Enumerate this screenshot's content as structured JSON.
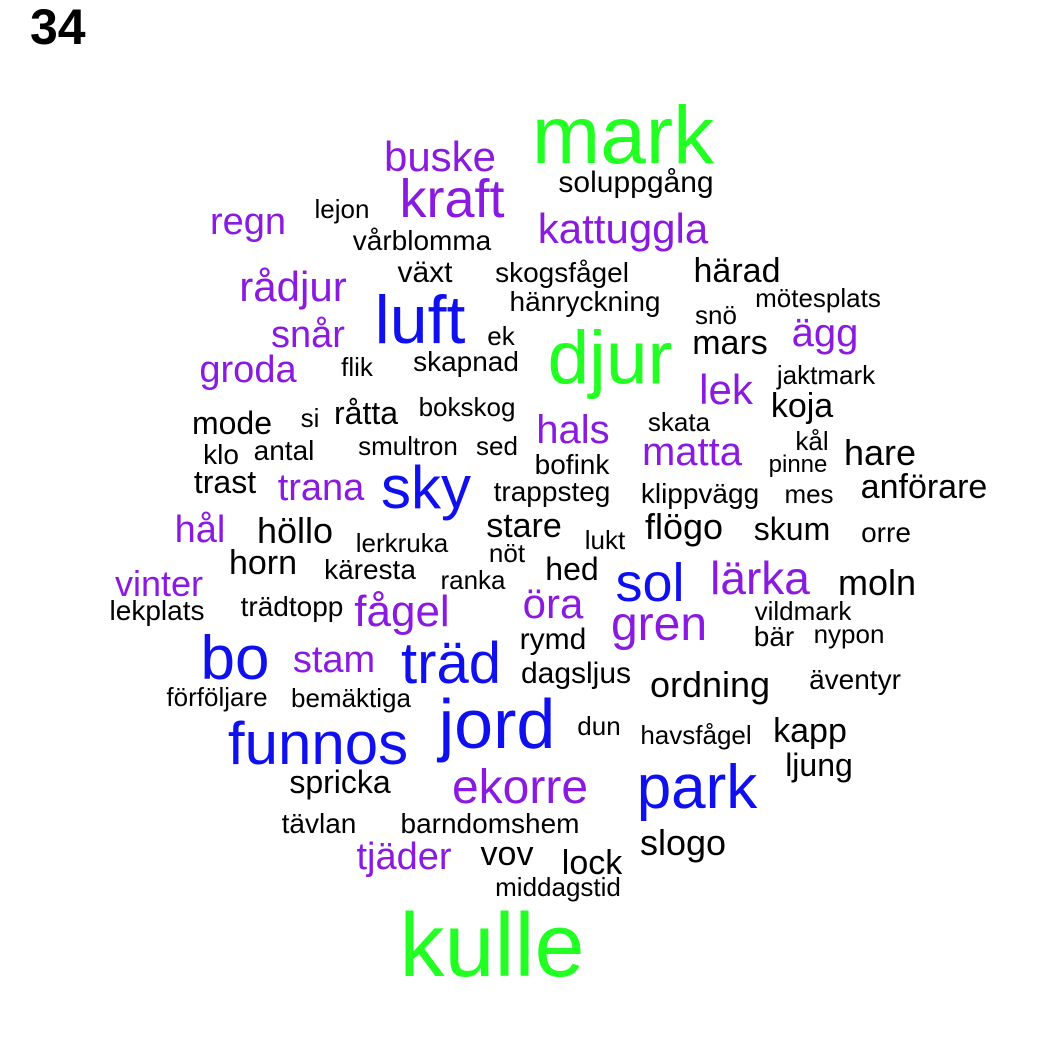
{
  "panel_number": "34",
  "colors": {
    "green": "#22ff22",
    "blue": "#1010ee",
    "purple": "#8a1ae0",
    "black": "#000000"
  },
  "words": [
    {
      "text": "mark",
      "color": "green"
    },
    {
      "text": "kulle",
      "color": "green"
    },
    {
      "text": "djur",
      "color": "green"
    },
    {
      "text": "luft",
      "color": "blue"
    },
    {
      "text": "sky",
      "color": "blue"
    },
    {
      "text": "sol",
      "color": "blue"
    },
    {
      "text": "bo",
      "color": "blue"
    },
    {
      "text": "träd",
      "color": "blue"
    },
    {
      "text": "jord",
      "color": "blue"
    },
    {
      "text": "funnos",
      "color": "blue"
    },
    {
      "text": "park",
      "color": "blue"
    },
    {
      "text": "buske",
      "color": "purple"
    },
    {
      "text": "kraft",
      "color": "purple"
    },
    {
      "text": "regn",
      "color": "purple"
    },
    {
      "text": "kattuggla",
      "color": "purple"
    },
    {
      "text": "rådjur",
      "color": "purple"
    },
    {
      "text": "snår",
      "color": "purple"
    },
    {
      "text": "ägg",
      "color": "purple"
    },
    {
      "text": "groda",
      "color": "purple"
    },
    {
      "text": "lek",
      "color": "purple"
    },
    {
      "text": "hals",
      "color": "purple"
    },
    {
      "text": "matta",
      "color": "purple"
    },
    {
      "text": "trana",
      "color": "purple"
    },
    {
      "text": "hål",
      "color": "purple"
    },
    {
      "text": "lärka",
      "color": "purple"
    },
    {
      "text": "vinter",
      "color": "purple"
    },
    {
      "text": "fågel",
      "color": "purple"
    },
    {
      "text": "öra",
      "color": "purple"
    },
    {
      "text": "gren",
      "color": "purple"
    },
    {
      "text": "stam",
      "color": "purple"
    },
    {
      "text": "ekorre",
      "color": "purple"
    },
    {
      "text": "tjäder",
      "color": "purple"
    },
    {
      "text": "soluppgång",
      "color": "black"
    },
    {
      "text": "lejon",
      "color": "black"
    },
    {
      "text": "vårblomma",
      "color": "black"
    },
    {
      "text": "växt",
      "color": "black"
    },
    {
      "text": "skogsfågel",
      "color": "black"
    },
    {
      "text": "härad",
      "color": "black"
    },
    {
      "text": "hänryckning",
      "color": "black"
    },
    {
      "text": "mötesplats",
      "color": "black"
    },
    {
      "text": "snö",
      "color": "black"
    },
    {
      "text": "ek",
      "color": "black"
    },
    {
      "text": "mars",
      "color": "black"
    },
    {
      "text": "flik",
      "color": "black"
    },
    {
      "text": "skapnad",
      "color": "black"
    },
    {
      "text": "jaktmark",
      "color": "black"
    },
    {
      "text": "koja",
      "color": "black"
    },
    {
      "text": "mode",
      "color": "black"
    },
    {
      "text": "si",
      "color": "black"
    },
    {
      "text": "råtta",
      "color": "black"
    },
    {
      "text": "bokskog",
      "color": "black"
    },
    {
      "text": "skata",
      "color": "black"
    },
    {
      "text": "kål",
      "color": "black"
    },
    {
      "text": "klo",
      "color": "black"
    },
    {
      "text": "antal",
      "color": "black"
    },
    {
      "text": "smultron",
      "color": "black"
    },
    {
      "text": "sed",
      "color": "black"
    },
    {
      "text": "bofink",
      "color": "black"
    },
    {
      "text": "pinne",
      "color": "black"
    },
    {
      "text": "hare",
      "color": "black"
    },
    {
      "text": "trast",
      "color": "black"
    },
    {
      "text": "trappsteg",
      "color": "black"
    },
    {
      "text": "klippvägg",
      "color": "black"
    },
    {
      "text": "mes",
      "color": "black"
    },
    {
      "text": "anförare",
      "color": "black"
    },
    {
      "text": "höllo",
      "color": "black"
    },
    {
      "text": "stare",
      "color": "black"
    },
    {
      "text": "flögo",
      "color": "black"
    },
    {
      "text": "skum",
      "color": "black"
    },
    {
      "text": "orre",
      "color": "black"
    },
    {
      "text": "lerkruka",
      "color": "black"
    },
    {
      "text": "lukt",
      "color": "black"
    },
    {
      "text": "nöt",
      "color": "black"
    },
    {
      "text": "horn",
      "color": "black"
    },
    {
      "text": "käresta",
      "color": "black"
    },
    {
      "text": "hed",
      "color": "black"
    },
    {
      "text": "ranka",
      "color": "black"
    },
    {
      "text": "moln",
      "color": "black"
    },
    {
      "text": "lekplats",
      "color": "black"
    },
    {
      "text": "trädtopp",
      "color": "black"
    },
    {
      "text": "vildmark",
      "color": "black"
    },
    {
      "text": "bär",
      "color": "black"
    },
    {
      "text": "nypon",
      "color": "black"
    },
    {
      "text": "rymd",
      "color": "black"
    },
    {
      "text": "dagsljus",
      "color": "black"
    },
    {
      "text": "ordning",
      "color": "black"
    },
    {
      "text": "äventyr",
      "color": "black"
    },
    {
      "text": "förföljare",
      "color": "black"
    },
    {
      "text": "bemäktiga",
      "color": "black"
    },
    {
      "text": "dun",
      "color": "black"
    },
    {
      "text": "havsfågel",
      "color": "black"
    },
    {
      "text": "kapp",
      "color": "black"
    },
    {
      "text": "ljung",
      "color": "black"
    },
    {
      "text": "spricka",
      "color": "black"
    },
    {
      "text": "tävlan",
      "color": "black"
    },
    {
      "text": "barndomshem",
      "color": "black"
    },
    {
      "text": "slogo",
      "color": "black"
    },
    {
      "text": "vov",
      "color": "black"
    },
    {
      "text": "lock",
      "color": "black"
    },
    {
      "text": "middagstid",
      "color": "black"
    }
  ]
}
